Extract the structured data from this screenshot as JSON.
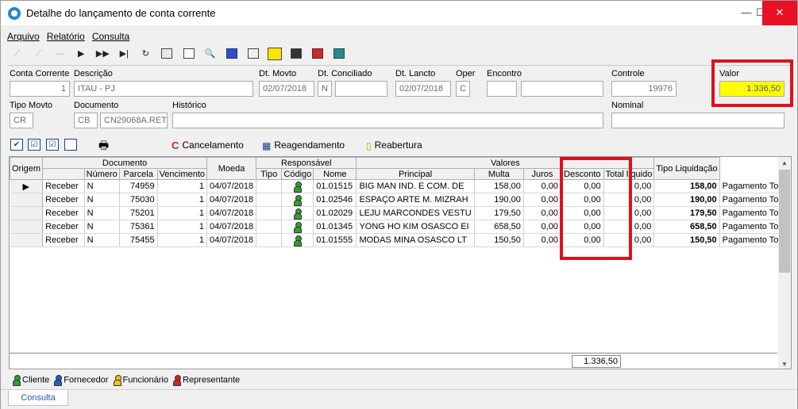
{
  "window": {
    "title": "Detalhe do lançamento de conta corrente",
    "minimize": "—",
    "maximize": "☐",
    "close": "✕"
  },
  "menu": [
    "Arquivo",
    "Relatório",
    "Consulta"
  ],
  "header": {
    "conta_corrente": {
      "label": "Conta Corrente",
      "value": "1"
    },
    "descricao": {
      "label": "Descrição",
      "value": "ITAU - PJ"
    },
    "dt_movto": {
      "label": "Dt. Movto",
      "value": "02/07/2018"
    },
    "dt_conciliado": {
      "label": "Dt. Conciliado",
      "value": "N"
    },
    "dt_lancto": {
      "label": "Dt. Lancto",
      "value": "02/07/2018"
    },
    "oper": {
      "label": "Oper",
      "value": "C"
    },
    "encontro": {
      "label": "Encontro",
      "value": ""
    },
    "controle": {
      "label": "Controle",
      "value": "19976"
    },
    "valor": {
      "label": "Valor",
      "value": "1.336,50"
    },
    "tipo_movto": {
      "label": "Tipo Movto",
      "value": "CR"
    },
    "documento": {
      "label": "Documento",
      "tipo": "CB",
      "value": "CN29068A.RET"
    },
    "historico": {
      "label": "Histórico",
      "value": ""
    },
    "nominal": {
      "label": "Nominal",
      "value": ""
    }
  },
  "actions": {
    "cancelamento": "Cancelamento",
    "reagendamento": "Reagendamento",
    "reabertura": "Reabertura"
  },
  "grid": {
    "groups": {
      "documento": "Documento",
      "responsavel": "Responsável",
      "valores": "Valores"
    },
    "columns": {
      "origem": "Origem",
      "numero": "Número",
      "parcela": "Parcela",
      "vencimento": "Vencimento",
      "moeda": "Moeda",
      "tipo": "Tipo",
      "codigo": "Código",
      "nome": "Nome",
      "principal": "Principal",
      "multa": "Multa",
      "juros": "Juros",
      "desconto": "Desconto",
      "total_liquido": "Total líquido",
      "tipo_liquidacao": "Tipo Liquidação"
    },
    "rows": [
      {
        "origem": "Receber",
        "flag": "N",
        "numero": "74959",
        "parcela": "1",
        "vencimento": "04/07/2018",
        "moeda": "",
        "codigo": "01.01515",
        "nome": "BIG MAN IND. E COM. DE",
        "principal": "158,00",
        "multa": "0,00",
        "juros": "0,00",
        "desconto": "0,00",
        "total": "158,00",
        "liquidacao": "Pagamento Total"
      },
      {
        "origem": "Receber",
        "flag": "N",
        "numero": "75030",
        "parcela": "1",
        "vencimento": "04/07/2018",
        "moeda": "",
        "codigo": "01.02546",
        "nome": "ESPAÇO ARTE M. MIZRAH",
        "principal": "190,00",
        "multa": "0,00",
        "juros": "0,00",
        "desconto": "0,00",
        "total": "190,00",
        "liquidacao": "Pagamento Total"
      },
      {
        "origem": "Receber",
        "flag": "N",
        "numero": "75201",
        "parcela": "1",
        "vencimento": "04/07/2018",
        "moeda": "",
        "codigo": "01.02029",
        "nome": "LEJU MARCONDES VESTU",
        "principal": "179,50",
        "multa": "0,00",
        "juros": "0,00",
        "desconto": "0,00",
        "total": "179,50",
        "liquidacao": "Pagamento Total"
      },
      {
        "origem": "Receber",
        "flag": "N",
        "numero": "75361",
        "parcela": "1",
        "vencimento": "04/07/2018",
        "moeda": "",
        "codigo": "01.01345",
        "nome": "YONG HO KIM OSASCO EI",
        "principal": "658,50",
        "multa": "0,00",
        "juros": "0,00",
        "desconto": "0,00",
        "total": "658,50",
        "liquidacao": "Pagamento Total"
      },
      {
        "origem": "Receber",
        "flag": "N",
        "numero": "75455",
        "parcela": "1",
        "vencimento": "04/07/2018",
        "moeda": "",
        "codigo": "01.01555",
        "nome": "MODAS MINA OSASCO LT",
        "principal": "150,50",
        "multa": "0,00",
        "juros": "0,00",
        "desconto": "0,00",
        "total": "150,50",
        "liquidacao": "Pagamento Total"
      }
    ],
    "total": "1.336,50"
  },
  "legend": [
    {
      "label": "Cliente",
      "color": "#2fa02f"
    },
    {
      "label": "Fornecedor",
      "color": "#1f5fd0"
    },
    {
      "label": "Funcionário",
      "color": "#f0c419"
    },
    {
      "label": "Representante",
      "color": "#d9261c"
    }
  ],
  "colors": {
    "highlight": "#e0101a",
    "valor_bg": "#ffff00",
    "tab_text": "#1a5fb4"
  },
  "tabs": [
    "Consulta"
  ]
}
